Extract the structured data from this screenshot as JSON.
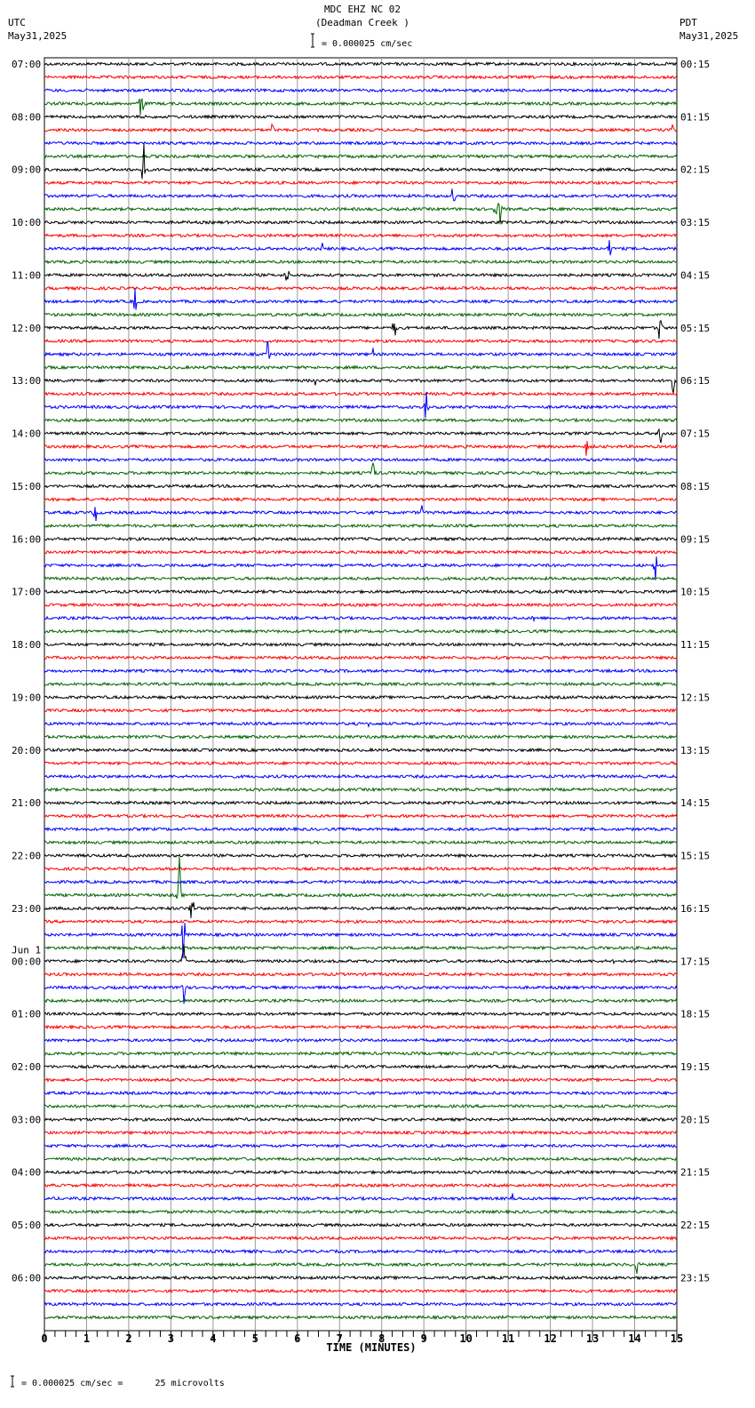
{
  "header": {
    "title": "MDC EHZ NC 02",
    "subtitle": "(Deadman Creek )",
    "left_tz": "UTC",
    "left_date": "May31,2025",
    "right_tz": "PDT",
    "right_date": "May31,2025",
    "scale_label": "= 0.000025 cm/sec"
  },
  "footer": {
    "scale_label": "= 0.000025 cm/sec =      25 microvolts"
  },
  "chart_data": {
    "type": "line",
    "title": "MDC EHZ NC 02 (Deadman Creek )",
    "xlabel": "TIME (MINUTES)",
    "xlim": [
      0,
      15
    ],
    "x_ticks": [
      "0",
      "1",
      "2",
      "3",
      "4",
      "5",
      "6",
      "7",
      "8",
      "9",
      "10",
      "11",
      "12",
      "13",
      "14",
      "15"
    ],
    "traces_per_hour": 4,
    "trace_colors": [
      "#000000",
      "#ff0000",
      "#0000ff",
      "#006400"
    ],
    "left_labels": [
      "07:00",
      "08:00",
      "09:00",
      "10:00",
      "11:00",
      "12:00",
      "13:00",
      "14:00",
      "15:00",
      "16:00",
      "17:00",
      "18:00",
      "19:00",
      "20:00",
      "21:00",
      "22:00",
      "23:00",
      "00:00",
      "01:00",
      "02:00",
      "03:00",
      "04:00",
      "05:00",
      "06:00"
    ],
    "date_change_label": "Jun 1",
    "right_labels": [
      "00:15",
      "01:15",
      "02:15",
      "03:15",
      "04:15",
      "05:15",
      "06:15",
      "07:15",
      "08:15",
      "09:15",
      "10:15",
      "11:15",
      "12:15",
      "13:15",
      "14:15",
      "15:15",
      "16:15",
      "17:15",
      "18:15",
      "19:15",
      "20:15",
      "21:15",
      "22:15",
      "23:15"
    ],
    "events": [
      {
        "trace": 3,
        "minute": 2.3,
        "amp": 55
      },
      {
        "trace": 5,
        "minute": 5.4,
        "amp": 10
      },
      {
        "trace": 5,
        "minute": 14.9,
        "amp": 18
      },
      {
        "trace": 8,
        "minute": 2.35,
        "amp": 45
      },
      {
        "trace": 10,
        "minute": 9.7,
        "amp": 45
      },
      {
        "trace": 11,
        "minute": 10.8,
        "amp": 35
      },
      {
        "trace": 11,
        "minute": 10.7,
        "amp": 15
      },
      {
        "trace": 14,
        "minute": 6.6,
        "amp": 10
      },
      {
        "trace": 14,
        "minute": 13.4,
        "amp": 20
      },
      {
        "trace": 16,
        "minute": 5.75,
        "amp": 20
      },
      {
        "trace": 18,
        "minute": 2.15,
        "amp": 25
      },
      {
        "trace": 20,
        "minute": 8.3,
        "amp": 22
      },
      {
        "trace": 20,
        "minute": 14.6,
        "amp": 30
      },
      {
        "trace": 22,
        "minute": 7.8,
        "amp": 20
      },
      {
        "trace": 22,
        "minute": 5.3,
        "amp": 30
      },
      {
        "trace": 24,
        "minute": 6.45,
        "amp": 18
      },
      {
        "trace": 24,
        "minute": 14.9,
        "amp": 25
      },
      {
        "trace": 26,
        "minute": 9.05,
        "amp": 25
      },
      {
        "trace": 28,
        "minute": 14.6,
        "amp": 35
      },
      {
        "trace": 29,
        "minute": 12.85,
        "amp": 22
      },
      {
        "trace": 31,
        "minute": 7.8,
        "amp": 25
      },
      {
        "trace": 34,
        "minute": 1.2,
        "amp": 22
      },
      {
        "trace": 34,
        "minute": 8.95,
        "amp": 10
      },
      {
        "trace": 38,
        "minute": 14.5,
        "amp": 25
      },
      {
        "trace": 42,
        "minute": 11.6,
        "amp": 5
      },
      {
        "trace": 50,
        "minute": 7.7,
        "amp": 8
      },
      {
        "trace": 52,
        "minute": 5.75,
        "amp": 6
      },
      {
        "trace": 63,
        "minute": 3.2,
        "amp": 55
      },
      {
        "trace": 64,
        "minute": 3.5,
        "amp": 45
      },
      {
        "trace": 66,
        "minute": 3.3,
        "amp": 50
      },
      {
        "trace": 68,
        "minute": 3.3,
        "amp": 55
      },
      {
        "trace": 68,
        "minute": 13.5,
        "amp": 8
      },
      {
        "trace": 70,
        "minute": 3.3,
        "amp": 40
      },
      {
        "trace": 86,
        "minute": 11.1,
        "amp": 8
      },
      {
        "trace": 91,
        "minute": 14.05,
        "amp": 14
      },
      {
        "trace": 95,
        "minute": 7.5,
        "amp": 5
      }
    ]
  }
}
